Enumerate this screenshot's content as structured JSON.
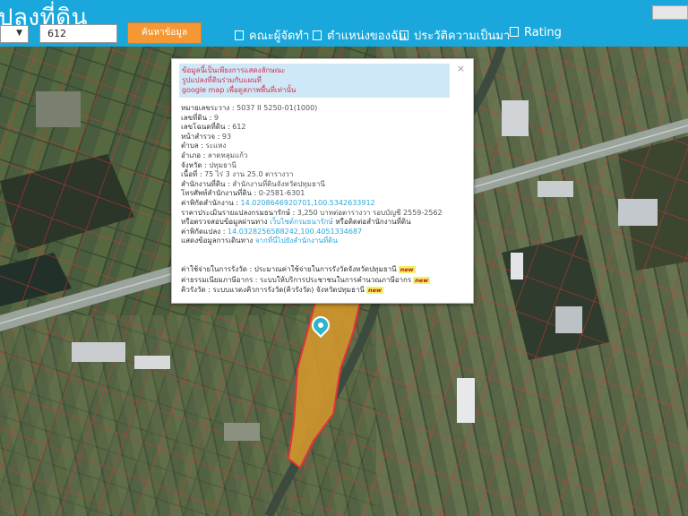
{
  "header": {
    "title": "ปลงที่ดิน",
    "corner_label": "",
    "parcel_input_value": "612",
    "search_button_label": "ค้นหาข้อมูล",
    "menu": [
      {
        "label": "คณะผู้จัดทำ"
      },
      {
        "label": "ตำแหน่งของฉัน"
      },
      {
        "label": "ประวัติความเป็นมา"
      },
      {
        "label": "Rating"
      }
    ]
  },
  "map": {
    "labels": {
      "road_label_1": "",
      "road_label_2": ""
    }
  },
  "popup": {
    "close_symbol": "×",
    "notice": [
      "ข้อมูลนี้เป็นเพียงการแสดงลักษณะ",
      "รูปแปลงที่ดินร่วมกับแผนที่",
      "google map เพื่อดูสภาพพื้นที่เท่านั้น"
    ],
    "fields": {
      "map_sheet": {
        "label": "หมายเลขระวาง",
        "value": "5037 II 5250-01(1000)"
      },
      "land_no": {
        "label": "เลขที่ดิน",
        "value": "9"
      },
      "deed_no": {
        "label": "เลขโฉนดที่ดิน",
        "value": "612"
      },
      "survey_page": {
        "label": "หน้าสำรวจ",
        "value": "93"
      },
      "subdistrict": {
        "label": "ตำบล",
        "value": "ระแหง"
      },
      "district": {
        "label": "อำเภอ",
        "value": "ลาดหลุมแก้ว"
      },
      "province": {
        "label": "จังหวัด",
        "value": "ปทุมธานี"
      },
      "area": {
        "label": "เนื้อที่",
        "value": "75 ไร่ 3 งาน 25.0 ตารางวา"
      },
      "land_office": {
        "label": "สำนักงานที่ดิน",
        "value": "สำนักงานที่ดินจังหวัดปทุมธานี"
      },
      "office_phone": {
        "label": "โทรศัพท์สำนักงานที่ดิน",
        "value": "0-2581-6301"
      },
      "office_coords": {
        "label": "ค่าพิกัดสำนักงาน",
        "value": "14.0208646920701,100.5342633912"
      },
      "appraisal": {
        "label": "ราคาประเมินรายแปลงกรมธนารักษ์",
        "value": "3,250 บาทต่อตารางวา รอบบัญชี 2559-2562"
      },
      "appraisal_check": {
        "prefix": "หรือตรวจสอบข้อมูลผ่านทาง",
        "link": "เว็บไซต์กรมธนารักษ์",
        "suffix": "หรือติดต่อสำนักงานที่ดิน"
      },
      "parcel_coords": {
        "label": "ค่าพิกัดแปลง",
        "value": "14.0328256588242,100.4051334687"
      },
      "directions": {
        "label": "แสดงข้อมูลการเดินทาง",
        "link": "จากที่นี่ไปยังสำนักงานที่ดิน"
      }
    },
    "links": [
      {
        "label": "ค่าใช้จ่ายในการรังวัด",
        "link": "ประมาณค่าใช้จ่ายในการรังวัดจังหวัดปทุมธานี",
        "badge": "new"
      },
      {
        "label": "ค่าธรรมเนียมภาษีอากร",
        "link": "ระบบให้บริการประชาชนในการคำนวณภาษีอากร",
        "badge": "new"
      },
      {
        "label": "คิวรังวัด",
        "link": "ระบบแวดงคิวการรังวัด(คิวรังวัด) จังหวัดปทุมธานี",
        "badge": "new"
      }
    ]
  },
  "colors": {
    "header_bg": "#1aa8dc",
    "search_button": "#f59733",
    "notice_bg": "#cfe8f7",
    "notice_text": "#d0314f",
    "link": "#2aa6de",
    "parcel_fill": "#d99a2b",
    "parcel_boundary": "#e0343a"
  }
}
